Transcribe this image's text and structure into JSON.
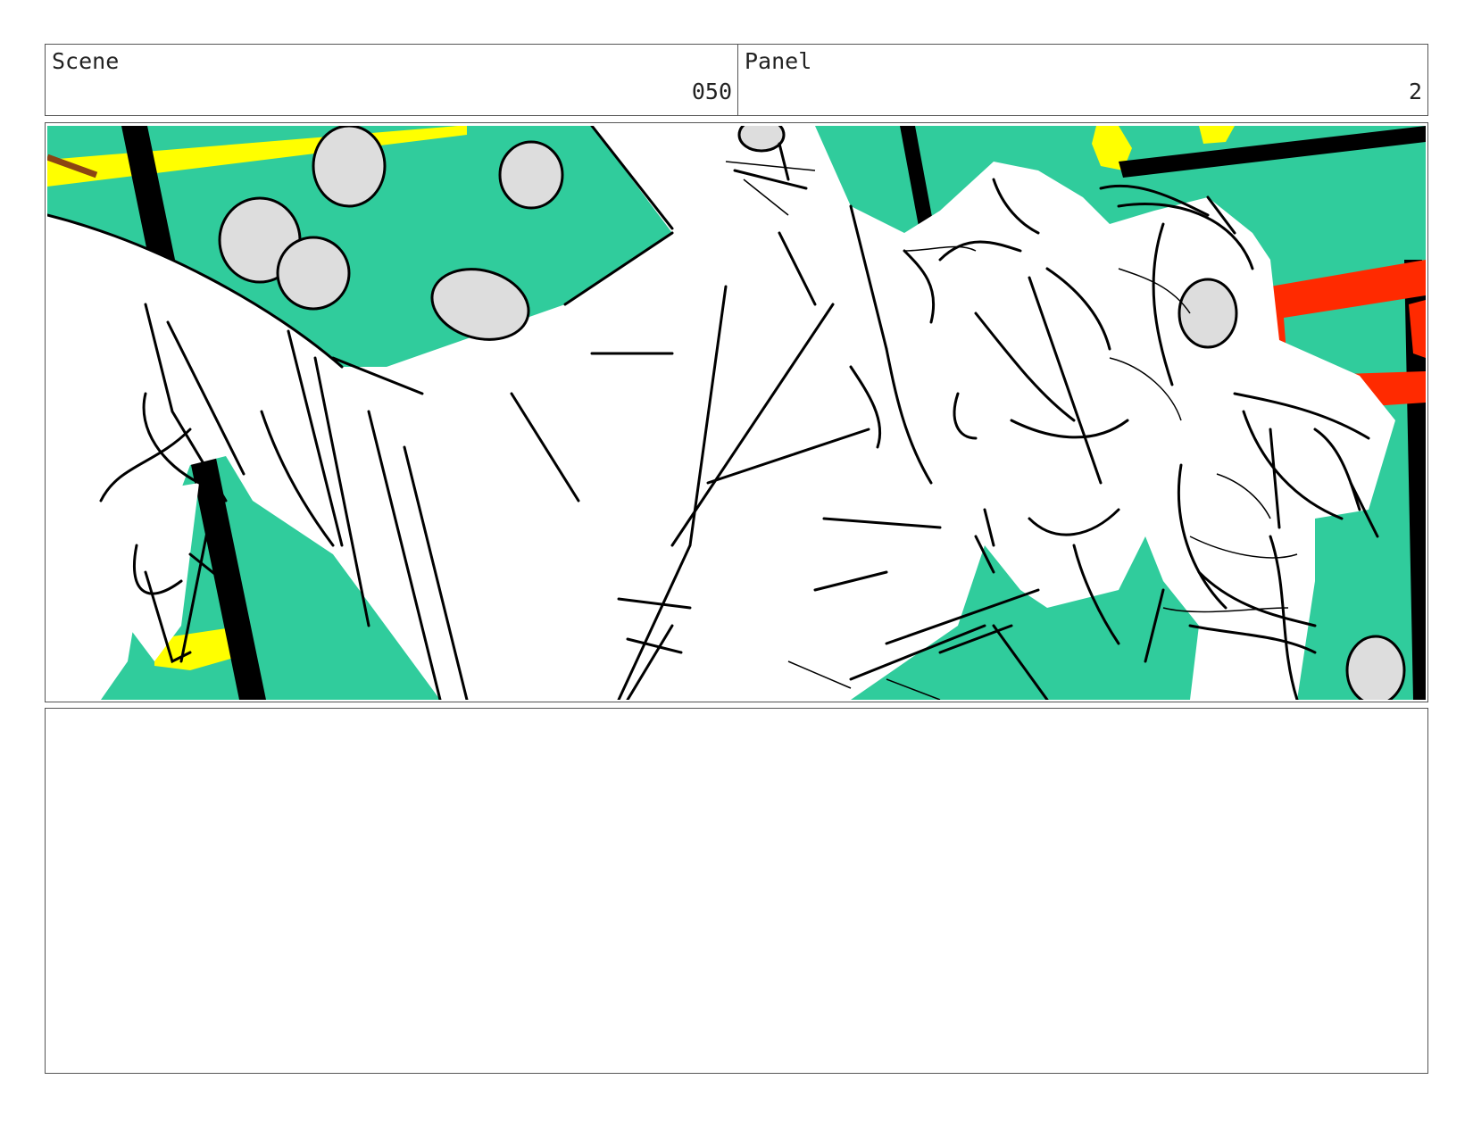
{
  "header": {
    "scene_label": "Scene",
    "scene_value": "050",
    "panel_label": "Panel",
    "panel_value": "2"
  },
  "panel_image": {
    "icon": "storyboard-sketch-image",
    "colors": {
      "background_green": "#30CC9C",
      "accent_yellow": "#FFFF00",
      "accent_red": "#FF2A00",
      "coin_gray": "#DDDDDD",
      "ink": "#000000",
      "brown": "#8B4513"
    }
  },
  "notes": {
    "text": ""
  }
}
